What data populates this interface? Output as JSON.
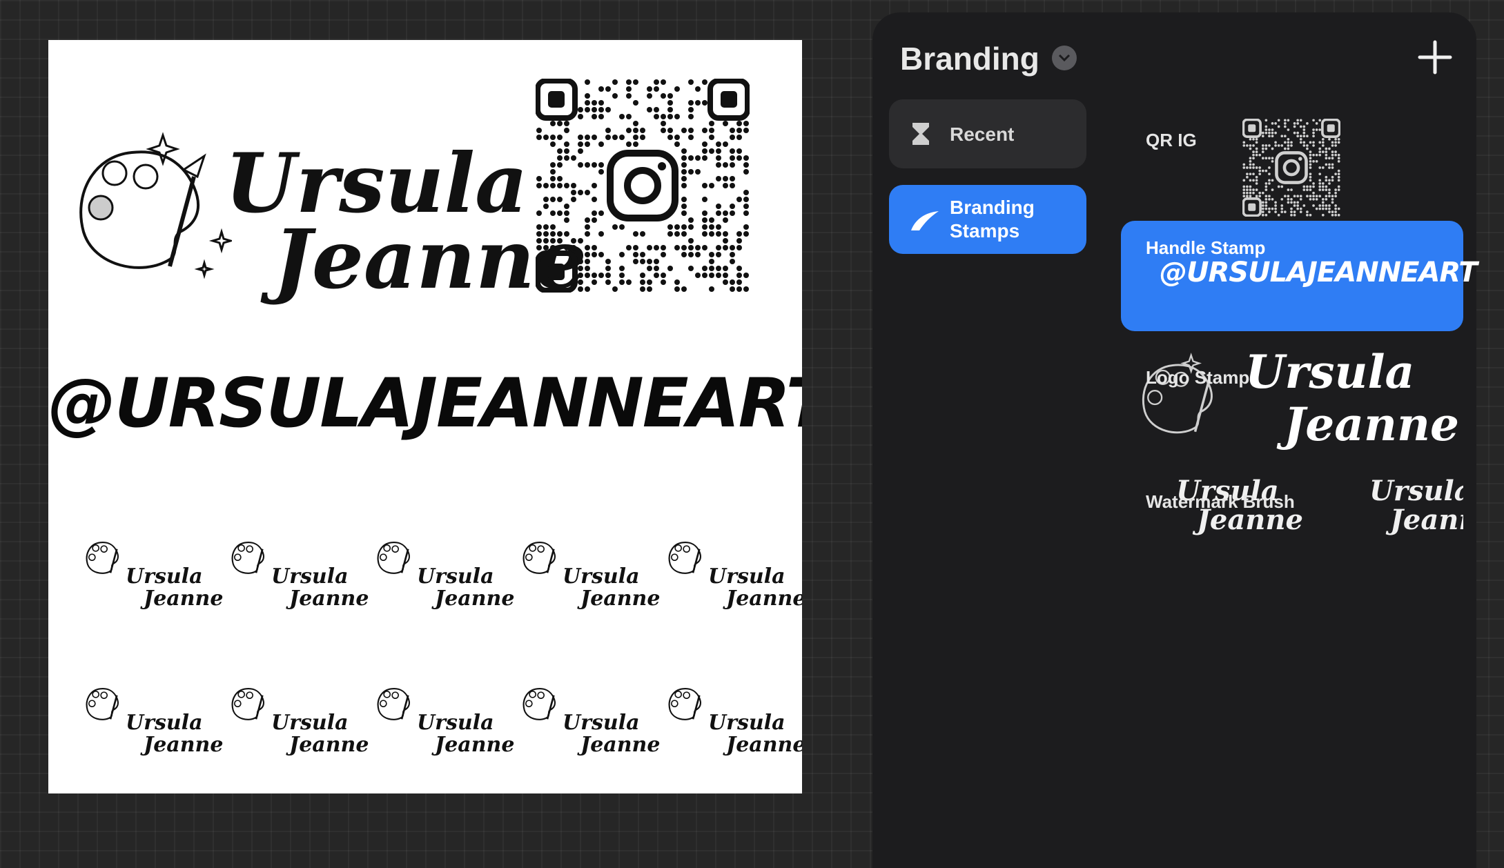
{
  "canvas": {
    "logo_name_line1": "Ursula",
    "logo_name_line2": "Jeanne",
    "handle": "@URSULAJEANNEART",
    "watermark_name_line1": "Ursula",
    "watermark_name_line2": "Jeanne"
  },
  "panel": {
    "title": "Branding",
    "categories": [
      {
        "label": "Recent",
        "icon": "hourglass-icon",
        "selected": false
      },
      {
        "label": "Branding Stamps",
        "icon": "brush-stroke-icon",
        "selected": true
      }
    ],
    "brushes": [
      {
        "label": "QR IG",
        "selected": false
      },
      {
        "label": "Handle Stamp",
        "preview": "@URSULAJEANNEART",
        "selected": true
      },
      {
        "label": "Logo Stamp",
        "preview_line1": "Ursula",
        "preview_line2": "Jeanne",
        "selected": false
      },
      {
        "label": "Watermark Brush",
        "preview_line1": "Ursula",
        "preview_line2": "Jeanne",
        "selected": false
      }
    ]
  },
  "colors": {
    "background": "#262626",
    "panel": "#1c1c1e",
    "accent": "#2f7df4",
    "canvas": "#ffffff"
  }
}
